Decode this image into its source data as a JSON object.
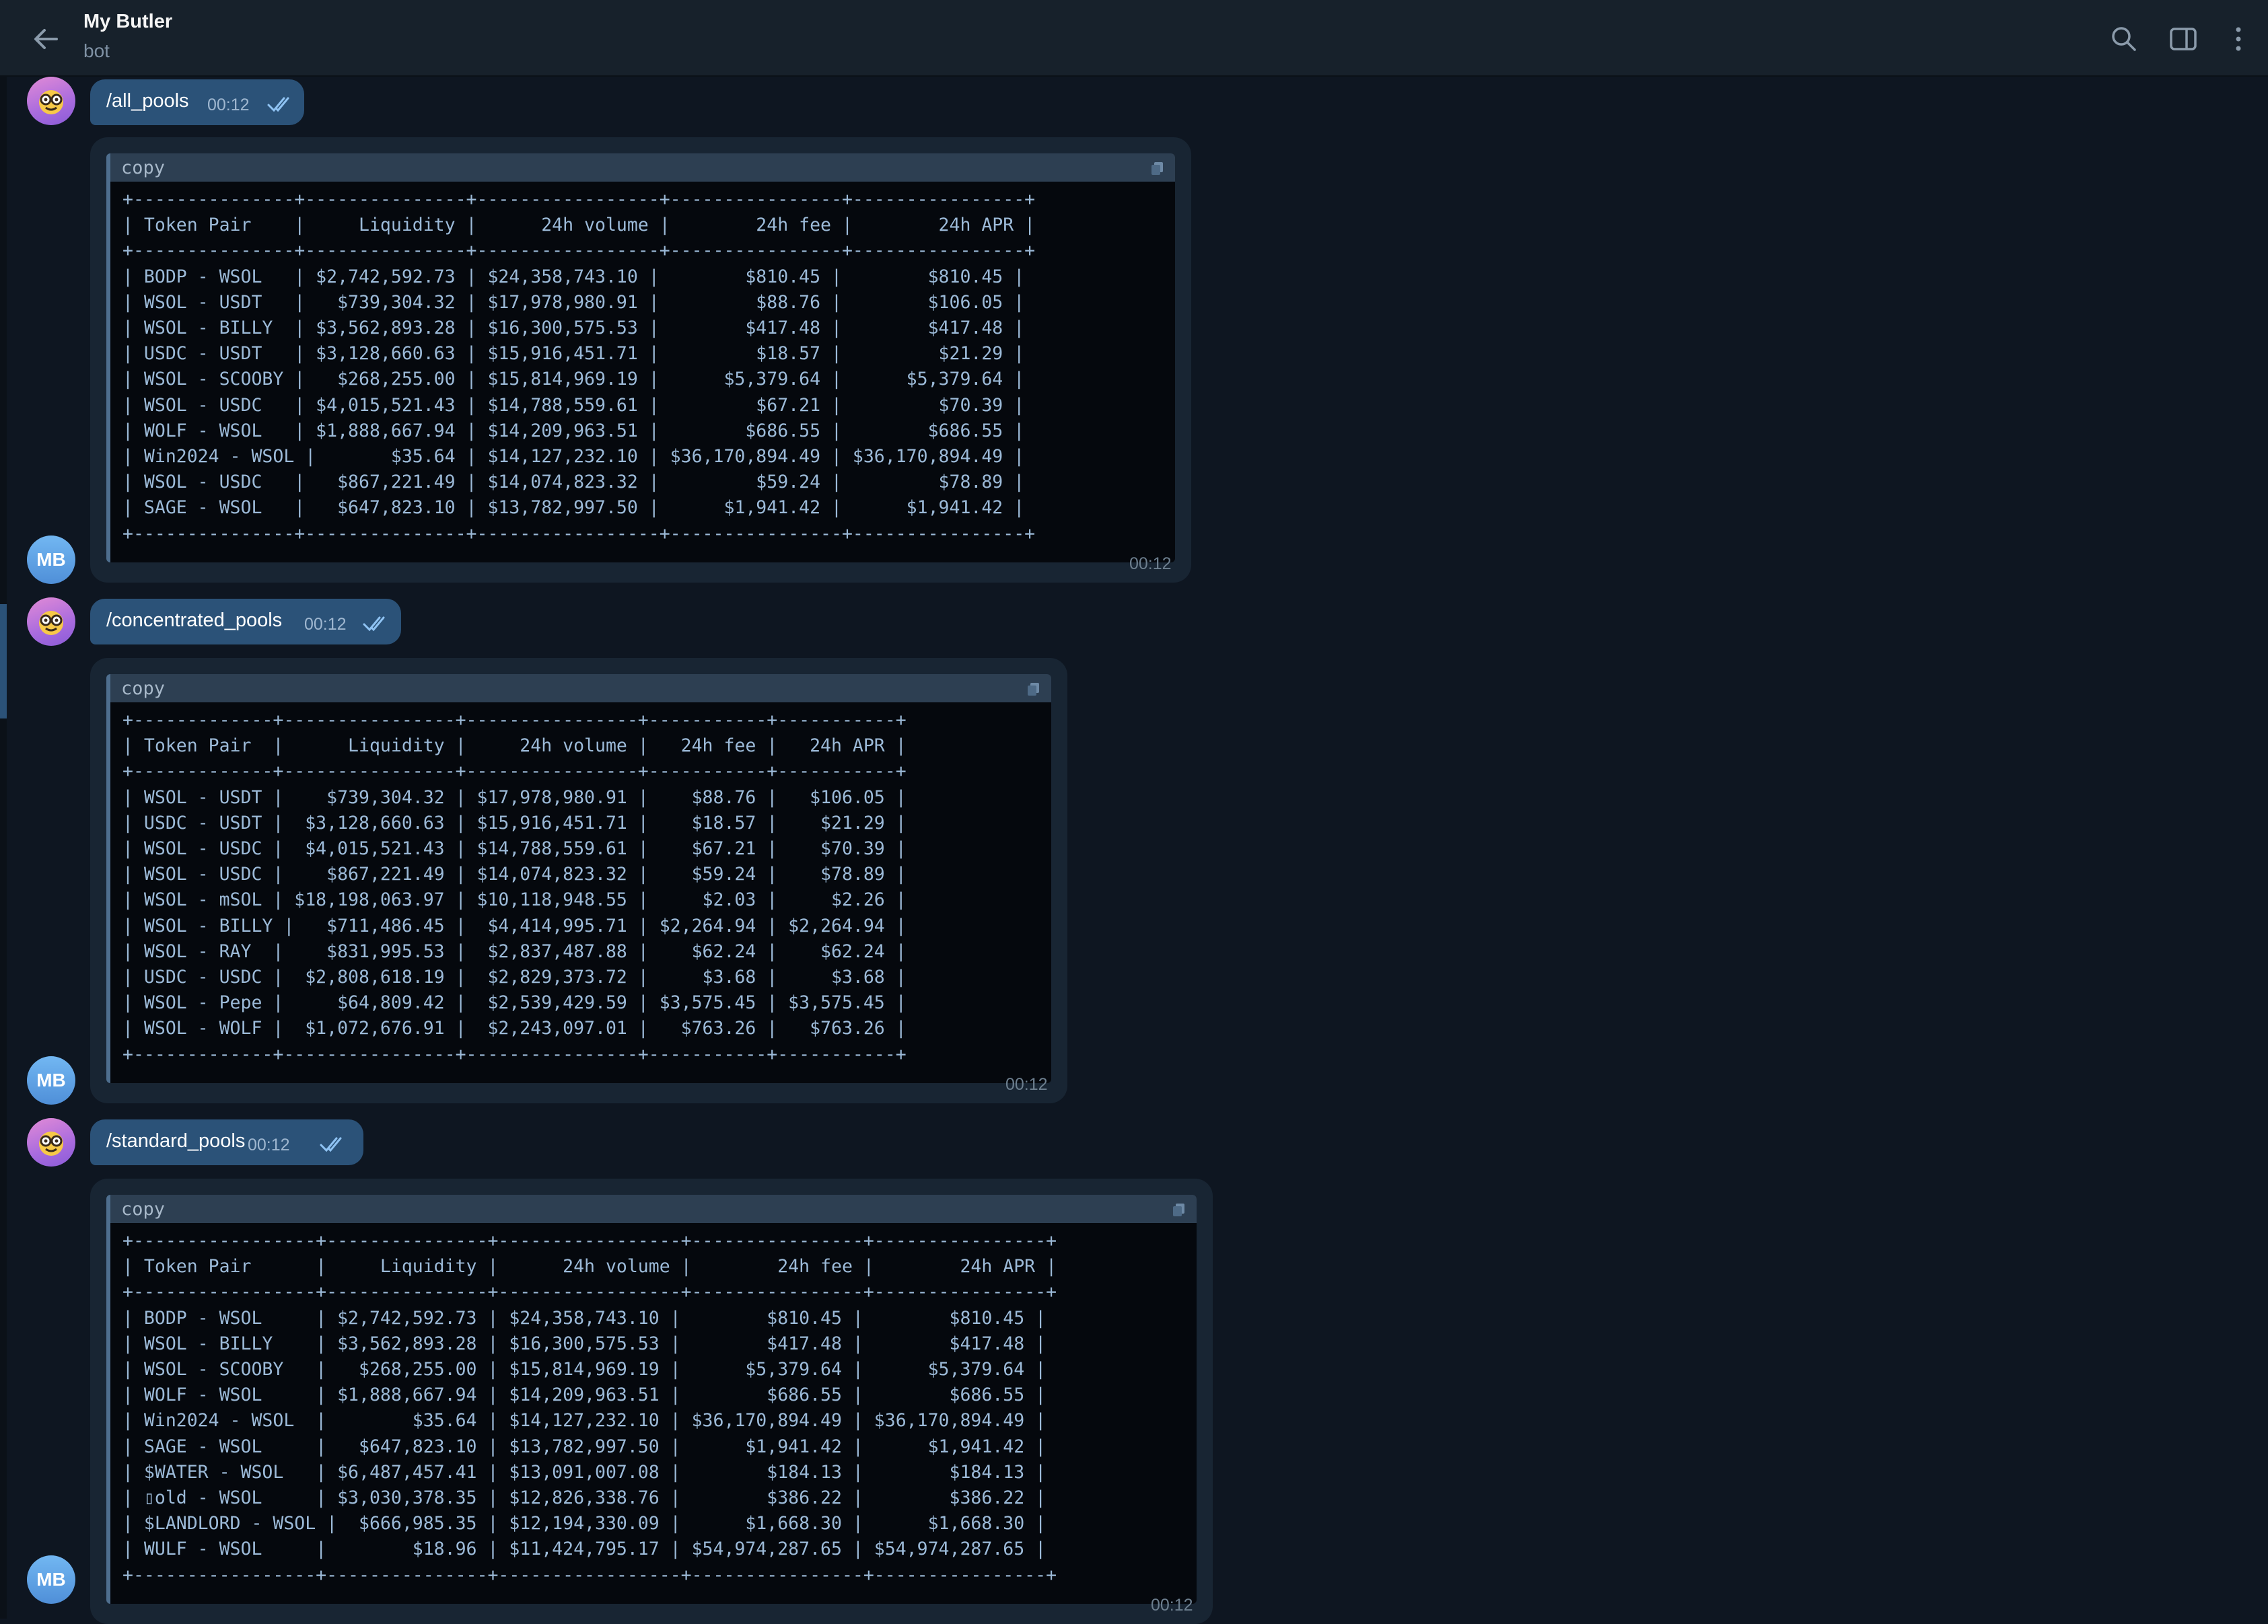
{
  "header": {
    "title": "My Butler",
    "subtitle": "bot",
    "icons": [
      "back-arrow-icon",
      "search-icon",
      "sidebar-toggle-icon",
      "more-vertical-icon"
    ]
  },
  "bot_avatar_initials": "MB",
  "colors": {
    "background": "#0e1621",
    "header": "#17212b",
    "outgoing_bubble": "#2b5278",
    "incoming_bubble": "#182533",
    "code_background": "#05080d",
    "code_text": "#9cbad8"
  },
  "messages": [
    {
      "command": "/all_pools",
      "command_time": "00:12",
      "copy_label": "copy",
      "reply_time": "00:12",
      "table": [
        "+---------------+---------------+-----------------+----------------+----------------+",
        "| Token Pair    |     Liquidity |      24h volume |        24h fee |        24h APR |",
        "+---------------+---------------+-----------------+----------------+----------------+",
        "| BODP - WSOL   | $2,742,592.73 | $24,358,743.10 |        $810.45 |        $810.45 |",
        "| WSOL - USDT   |   $739,304.32 | $17,978,980.91 |         $88.76 |        $106.05 |",
        "| WSOL - BILLY  | $3,562,893.28 | $16,300,575.53 |        $417.48 |        $417.48 |",
        "| USDC - USDT   | $3,128,660.63 | $15,916,451.71 |         $18.57 |         $21.29 |",
        "| WSOL - SCOOBY |   $268,255.00 | $15,814,969.19 |      $5,379.64 |      $5,379.64 |",
        "| WSOL - USDC   | $4,015,521.43 | $14,788,559.61 |         $67.21 |         $70.39 |",
        "| WOLF - WSOL   | $1,888,667.94 | $14,209,963.51 |        $686.55 |        $686.55 |",
        "| Win2024 - WSOL |       $35.64 | $14,127,232.10 | $36,170,894.49 | $36,170,894.49 |",
        "| WSOL - USDC   |   $867,221.49 | $14,074,823.32 |         $59.24 |         $78.89 |",
        "| SAGE - WSOL   |   $647,823.10 | $13,782,997.50 |      $1,941.42 |      $1,941.42 |",
        "+---------------+---------------+-----------------+----------------+----------------+"
      ]
    },
    {
      "command": "/concentrated_pools",
      "command_time": "00:12",
      "copy_label": "copy",
      "reply_time": "00:12",
      "table": [
        "+-------------+----------------+----------------+-----------+-----------+",
        "| Token Pair  |      Liquidity |     24h volume |   24h fee |   24h APR |",
        "+-------------+----------------+----------------+-----------+-----------+",
        "| WSOL - USDT |    $739,304.32 | $17,978,980.91 |    $88.76 |   $106.05 |",
        "| USDC - USDT |  $3,128,660.63 | $15,916,451.71 |    $18.57 |    $21.29 |",
        "| WSOL - USDC |  $4,015,521.43 | $14,788,559.61 |    $67.21 |    $70.39 |",
        "| WSOL - USDC |    $867,221.49 | $14,074,823.32 |    $59.24 |    $78.89 |",
        "| WSOL - mSOL | $18,198,063.97 | $10,118,948.55 |     $2.03 |     $2.26 |",
        "| WSOL - BILLY |   $711,486.45 |  $4,414,995.71 | $2,264.94 | $2,264.94 |",
        "| WSOL - RAY  |    $831,995.53 |  $2,837,487.88 |    $62.24 |    $62.24 |",
        "| USDC - USDC |  $2,808,618.19 |  $2,829,373.72 |     $3.68 |     $3.68 |",
        "| WSOL - Pepe |     $64,809.42 |  $2,539,429.59 | $3,575.45 | $3,575.45 |",
        "| WSOL - WOLF |  $1,072,676.91 |  $2,243,097.01 |   $763.26 |   $763.26 |",
        "+-------------+----------------+----------------+-----------+-----------+"
      ]
    },
    {
      "command": "/standard_pools",
      "command_time": "00:12",
      "copy_label": "copy",
      "reply_time": "00:12",
      "table": [
        "+-----------------+---------------+-----------------+----------------+----------------+",
        "| Token Pair      |     Liquidity |      24h volume |        24h fee |        24h APR |",
        "+-----------------+---------------+-----------------+----------------+----------------+",
        "| BODP - WSOL     | $2,742,592.73 | $24,358,743.10 |        $810.45 |        $810.45 |",
        "| WSOL - BILLY    | $3,562,893.28 | $16,300,575.53 |        $417.48 |        $417.48 |",
        "| WSOL - SCOOBY   |   $268,255.00 | $15,814,969.19 |      $5,379.64 |      $5,379.64 |",
        "| WOLF - WSOL     | $1,888,667.94 | $14,209,963.51 |        $686.55 |        $686.55 |",
        "| Win2024 - WSOL  |        $35.64 | $14,127,232.10 | $36,170,894.49 | $36,170,894.49 |",
        "| SAGE - WSOL     |   $647,823.10 | $13,782,997.50 |      $1,941.42 |      $1,941.42 |",
        "| $WATER - WSOL   | $6,487,457.41 | $13,091,007.08 |        $184.13 |        $184.13 |",
        "| ▯old - WSOL     | $3,030,378.35 | $12,826,338.76 |        $386.22 |        $386.22 |",
        "| $LANDLORD - WSOL |  $666,985.35 | $12,194,330.09 |      $1,668.30 |      $1,668.30 |",
        "| WULF - WSOL     |        $18.96 | $11,424,795.17 | $54,974,287.65 | $54,974,287.65 |",
        "+-----------------+---------------+-----------------+----------------+----------------+"
      ]
    }
  ]
}
